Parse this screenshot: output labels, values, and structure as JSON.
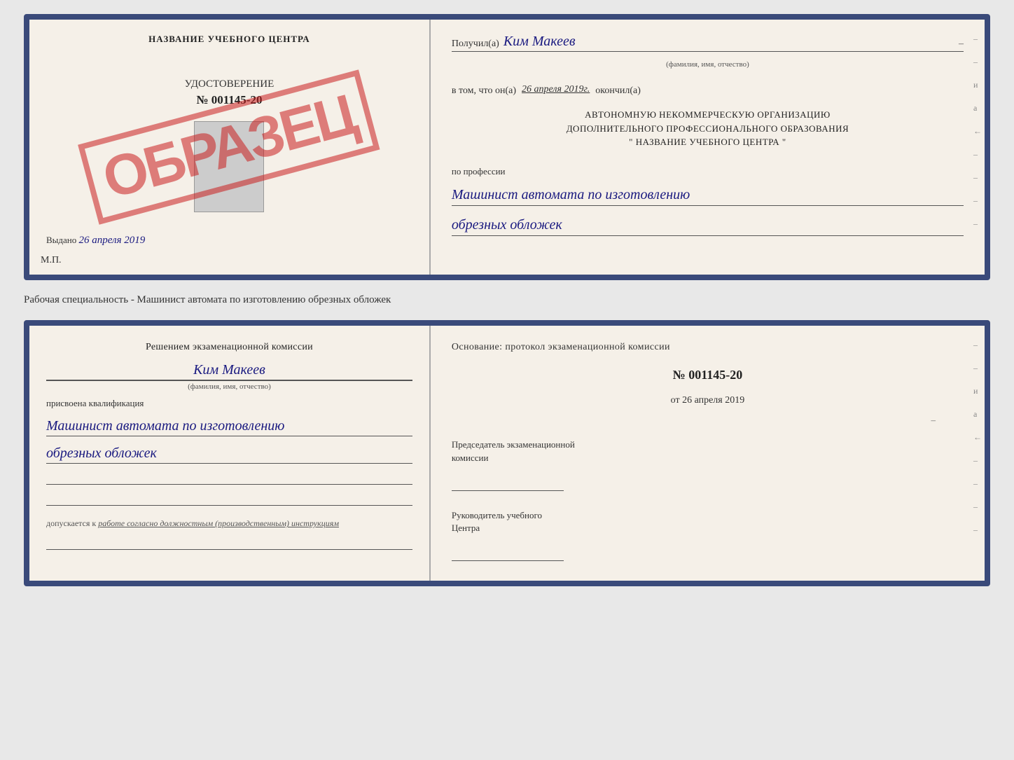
{
  "top_cert": {
    "left": {
      "school_name": "НАЗВАНИЕ УЧЕБНОГО ЦЕНТРА",
      "cert_type": "УДОСТОВЕРЕНИЕ",
      "cert_number": "№ 001145-20",
      "stamp_text": "ОБРАЗЕЦ",
      "issued_label": "Выдано",
      "issued_date": "26 апреля 2019",
      "mp_label": "М.П."
    },
    "right": {
      "received_prefix": "Получил(а)",
      "recipient_name": "Ким Макеев",
      "fio_label": "(фамилия, имя, отчество)",
      "in_that_prefix": "в том, что он(а)",
      "completion_date": "26 апреля 2019г.",
      "completed_label": "окончил(а)",
      "org_line1": "АВТОНОМНУЮ НЕКОММЕРЧЕСКУЮ ОРГАНИЗАЦИЮ",
      "org_line2": "ДОПОЛНИТЕЛЬНОГО ПРОФЕССИОНАЛЬНОГО ОБРАЗОВАНИЯ",
      "org_quote": "\"",
      "school_name_right": "НАЗВАНИЕ УЧЕБНОГО ЦЕНТРА",
      "profession_prefix": "по профессии",
      "profession_line1": "Машинист автомата по изготовлению",
      "profession_line2": "обрезных обложек"
    }
  },
  "separator": {
    "text": "Рабочая специальность - Машинист автомата по изготовлению обрезных обложек"
  },
  "bottom_cert": {
    "left": {
      "decision_line1": "Решением экзаменационной комиссии",
      "person_name": "Ким Макеев",
      "fio_label": "(фамилия, имя, отчество)",
      "qualification_prefix": "присвоена квалификация",
      "qualification_line1": "Машинист автомата по изготовлению",
      "qualification_line2": "обрезных обложек",
      "допускается_prefix": "допускается к",
      "допускается_italic": "работе согласно должностным (производственным) инструкциям"
    },
    "right": {
      "foundation_label": "Основание: протокол экзаменационной комиссии",
      "protocol_number": "№ 001145-20",
      "date_prefix": "от",
      "protocol_date": "26 апреля 2019",
      "chairman_label": "Председатель экзаменационной",
      "chairman_label2": "комиссии",
      "director_label": "Руководитель учебного",
      "director_label2": "Центра"
    }
  },
  "edge_marks": [
    "–",
    "–",
    "и",
    "а",
    "←",
    "–",
    "–",
    "–",
    "–"
  ]
}
